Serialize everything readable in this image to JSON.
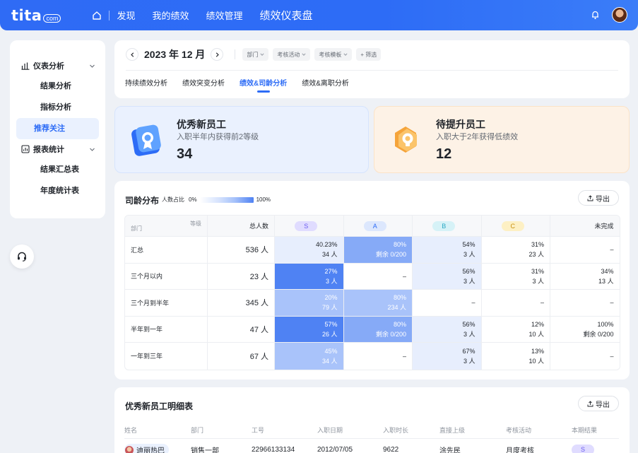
{
  "topbar": {
    "logo_text": "tita",
    "logo_suffix": "com",
    "nav": [
      "发现",
      "我的绩效",
      "绩效管理",
      "绩效仪表盘"
    ]
  },
  "sidebar": {
    "group1": "仪表分析",
    "group1_items": [
      "结果分析",
      "指标分析",
      "推荐关注"
    ],
    "group2": "报表统计",
    "group2_items": [
      "结果汇总表",
      "年度统计表"
    ],
    "active_item": "推荐关注"
  },
  "filters": {
    "date": "2023 年 12 月",
    "chips": [
      "部门",
      "考核活动",
      "考核模板",
      "+ 筛选"
    ],
    "tabs": [
      "持续绩效分析",
      "绩效突变分析",
      "绩效&司龄分析",
      "绩效&离职分析"
    ],
    "active_tab": "绩效&司龄分析"
  },
  "kpis": {
    "excellent": {
      "title": "优秀新员工",
      "subtitle": "入职半年内获得前2等级",
      "value": "34"
    },
    "improve": {
      "title": "待提升员工",
      "subtitle": "入职大于2年获得低绩效",
      "value": "12"
    }
  },
  "distribution": {
    "title": "司龄分布",
    "legend_label": "人数占比",
    "legend_min": "0%",
    "legend_max": "100%",
    "export_label": "导出",
    "header": {
      "level": "等级",
      "dept": "部门",
      "total": "总人数",
      "grades": [
        "S",
        "A",
        "B",
        "C"
      ],
      "incomplete": "未完成"
    },
    "rows": [
      {
        "dept": "汇总",
        "total": "536 人",
        "cells": [
          {
            "v1": "40.23%",
            "v2": "34 人",
            "heat": 1
          },
          {
            "v1": "80%",
            "v2": "剩余 0/200",
            "heat": 3
          },
          {
            "v1": "54%",
            "v2": "3 人",
            "heat": 1
          },
          {
            "v1": "31%",
            "v2": "23 人",
            "heat": 0
          },
          {
            "v1": "–",
            "v2": "",
            "heat": 0
          }
        ]
      },
      {
        "dept": "三个月以内",
        "total": "23 人",
        "cells": [
          {
            "v1": "27%",
            "v2": "3 人",
            "heat": 4
          },
          {
            "v1": "–",
            "v2": "",
            "heat": 0
          },
          {
            "v1": "56%",
            "v2": "3 人",
            "heat": 1
          },
          {
            "v1": "31%",
            "v2": "3 人",
            "heat": 0
          },
          {
            "v1": "34%",
            "v2": "13 人",
            "heat": 0
          }
        ]
      },
      {
        "dept": "三个月到半年",
        "total": "345 人",
        "cells": [
          {
            "v1": "20%",
            "v2": "79 人",
            "heat": 2
          },
          {
            "v1": "80%",
            "v2": "234 人",
            "heat": 2
          },
          {
            "v1": "–",
            "v2": "",
            "heat": 0
          },
          {
            "v1": "–",
            "v2": "",
            "heat": 0
          },
          {
            "v1": "–",
            "v2": "",
            "heat": 0
          }
        ]
      },
      {
        "dept": "半年到一年",
        "total": "47 人",
        "cells": [
          {
            "v1": "57%",
            "v2": "26 人",
            "heat": 4
          },
          {
            "v1": "80%",
            "v2": "剩余 0/200",
            "heat": 3
          },
          {
            "v1": "56%",
            "v2": "3 人",
            "heat": 1
          },
          {
            "v1": "12%",
            "v2": "10 人",
            "heat": 0
          },
          {
            "v1": "100%",
            "v2": "剩余 0/200",
            "heat": 0
          }
        ]
      },
      {
        "dept": "一年到三年",
        "total": "67 人",
        "cells": [
          {
            "v1": "45%",
            "v2": "34 人",
            "heat": 2
          },
          {
            "v1": "–",
            "v2": "",
            "heat": 0
          },
          {
            "v1": "67%",
            "v2": "3 人",
            "heat": 1
          },
          {
            "v1": "13%",
            "v2": "10 人",
            "heat": 0
          },
          {
            "v1": "–",
            "v2": "",
            "heat": 0
          }
        ]
      }
    ]
  },
  "detail": {
    "title": "优秀新员工明细表",
    "export_label": "导出",
    "columns": [
      "姓名",
      "部门",
      "工号",
      "入职日期",
      "入职时长",
      "直接上级",
      "考核活动",
      "本期结果"
    ],
    "row": {
      "name": "迪丽热巴",
      "dept": "销售一部",
      "id": "22966133134",
      "join_date": "2012/07/05",
      "tenure": "9622",
      "manager": "涂先民",
      "activity": "月度考核",
      "result": "S"
    }
  },
  "colors": {
    "primary": "#2d6cf6",
    "grade_S_bg": "#e0dcff",
    "grade_S_fg": "#6a5cf0",
    "grade_A_bg": "#dce7fd",
    "grade_A_fg": "#2d6cf6",
    "grade_B_bg": "#d6f2f7",
    "grade_B_fg": "#2aa8c4",
    "grade_C_bg": "#fdf0c4",
    "grade_C_fg": "#c7900f"
  }
}
